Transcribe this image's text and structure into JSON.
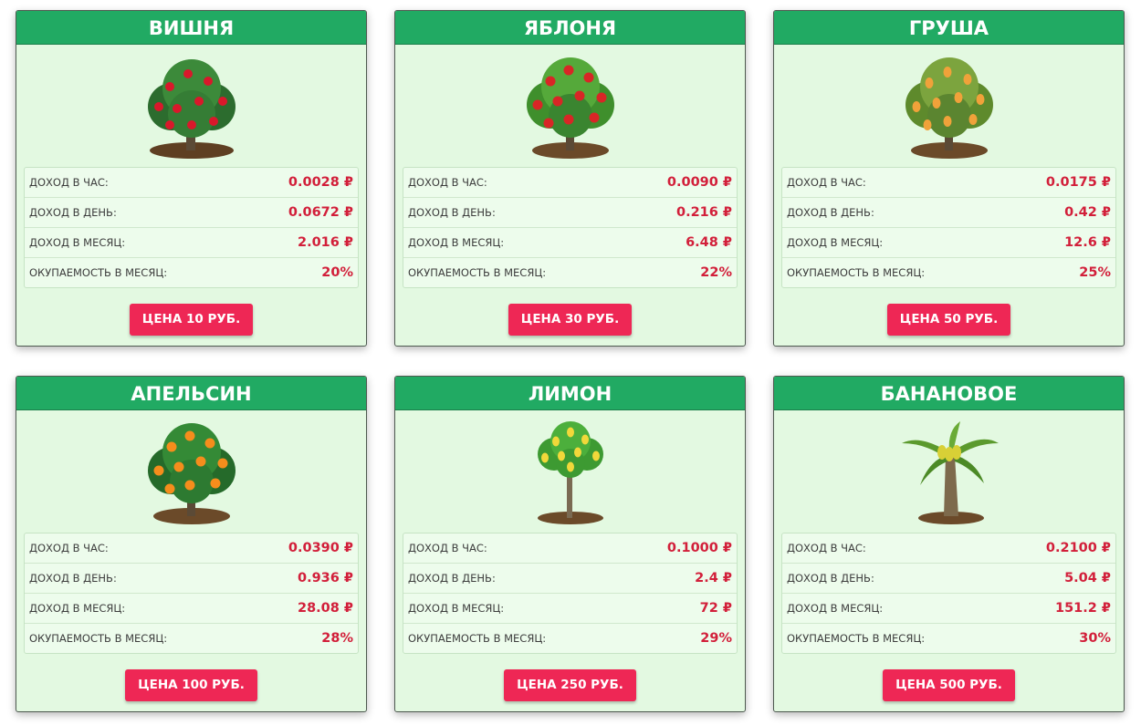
{
  "cards": [
    {
      "title": "ВИШНЯ",
      "tree": "cherry-tree-icon",
      "rows": [
        {
          "label": "ДОХОД В ЧАС:",
          "value": "0.0028 ₽"
        },
        {
          "label": "ДОХОД В ДЕНЬ:",
          "value": "0.0672 ₽"
        },
        {
          "label": "ДОХОД В МЕСЯЦ:",
          "value": "2.016 ₽"
        },
        {
          "label": "ОКУПАЕМОСТЬ В МЕСЯЦ:",
          "value": "20%"
        }
      ],
      "button": "ЦЕНА 10 РУБ."
    },
    {
      "title": "ЯБЛОНЯ",
      "tree": "apple-tree-icon",
      "rows": [
        {
          "label": "ДОХОД В ЧАС:",
          "value": "0.0090 ₽"
        },
        {
          "label": "ДОХОД В ДЕНЬ:",
          "value": "0.216 ₽"
        },
        {
          "label": "ДОХОД В МЕСЯЦ:",
          "value": "6.48 ₽"
        },
        {
          "label": "ОКУПАЕМОСТЬ В МЕСЯЦ:",
          "value": "22%"
        }
      ],
      "button": "ЦЕНА 30 РУБ."
    },
    {
      "title": "ГРУША",
      "tree": "pear-tree-icon",
      "rows": [
        {
          "label": "ДОХОД В ЧАС:",
          "value": "0.0175 ₽"
        },
        {
          "label": "ДОХОД В ДЕНЬ:",
          "value": "0.42 ₽"
        },
        {
          "label": "ДОХОД В МЕСЯЦ:",
          "value": "12.6 ₽"
        },
        {
          "label": "ОКУПАЕМОСТЬ В МЕСЯЦ:",
          "value": "25%"
        }
      ],
      "button": "ЦЕНА 50 РУБ."
    },
    {
      "title": "АПЕЛЬСИН",
      "tree": "orange-tree-icon",
      "rows": [
        {
          "label": "ДОХОД В ЧАС:",
          "value": "0.0390 ₽"
        },
        {
          "label": "ДОХОД В ДЕНЬ:",
          "value": "0.936 ₽"
        },
        {
          "label": "ДОХОД В МЕСЯЦ:",
          "value": "28.08 ₽"
        },
        {
          "label": "ОКУПАЕМОСТЬ В МЕСЯЦ:",
          "value": "28%"
        }
      ],
      "button": "ЦЕНА 100 РУБ."
    },
    {
      "title": "ЛИМОН",
      "tree": "lemon-tree-icon",
      "rows": [
        {
          "label": "ДОХОД В ЧАС:",
          "value": "0.1000 ₽"
        },
        {
          "label": "ДОХОД В ДЕНЬ:",
          "value": "2.4 ₽"
        },
        {
          "label": "ДОХОД В МЕСЯЦ:",
          "value": "72 ₽"
        },
        {
          "label": "ОКУПАЕМОСТЬ В МЕСЯЦ:",
          "value": "29%"
        }
      ],
      "button": "ЦЕНА 250 РУБ."
    },
    {
      "title": "БАНАНОВОЕ",
      "tree": "banana-tree-icon",
      "rows": [
        {
          "label": "ДОХОД В ЧАС:",
          "value": "0.2100 ₽"
        },
        {
          "label": "ДОХОД В ДЕНЬ:",
          "value": "5.04 ₽"
        },
        {
          "label": "ДОХОД В МЕСЯЦ:",
          "value": "151.2 ₽"
        },
        {
          "label": "ОКУПАЕМОСТЬ В МЕСЯЦ:",
          "value": "30%"
        }
      ],
      "button": "ЦЕНА 500 РУБ."
    }
  ],
  "colors": {
    "header_green": "#21aa63",
    "card_bg": "#e3f9e1",
    "value_red": "#d21f3a",
    "button_pink": "#ee2755",
    "cherry_fruit": "#d9182b",
    "apple_fruit": "#d82626",
    "pear_fruit": "#f0a23a",
    "orange_fruit": "#f58d1c",
    "lemon_fruit": "#f1d83a",
    "banana_fruit": "#d8d036"
  }
}
